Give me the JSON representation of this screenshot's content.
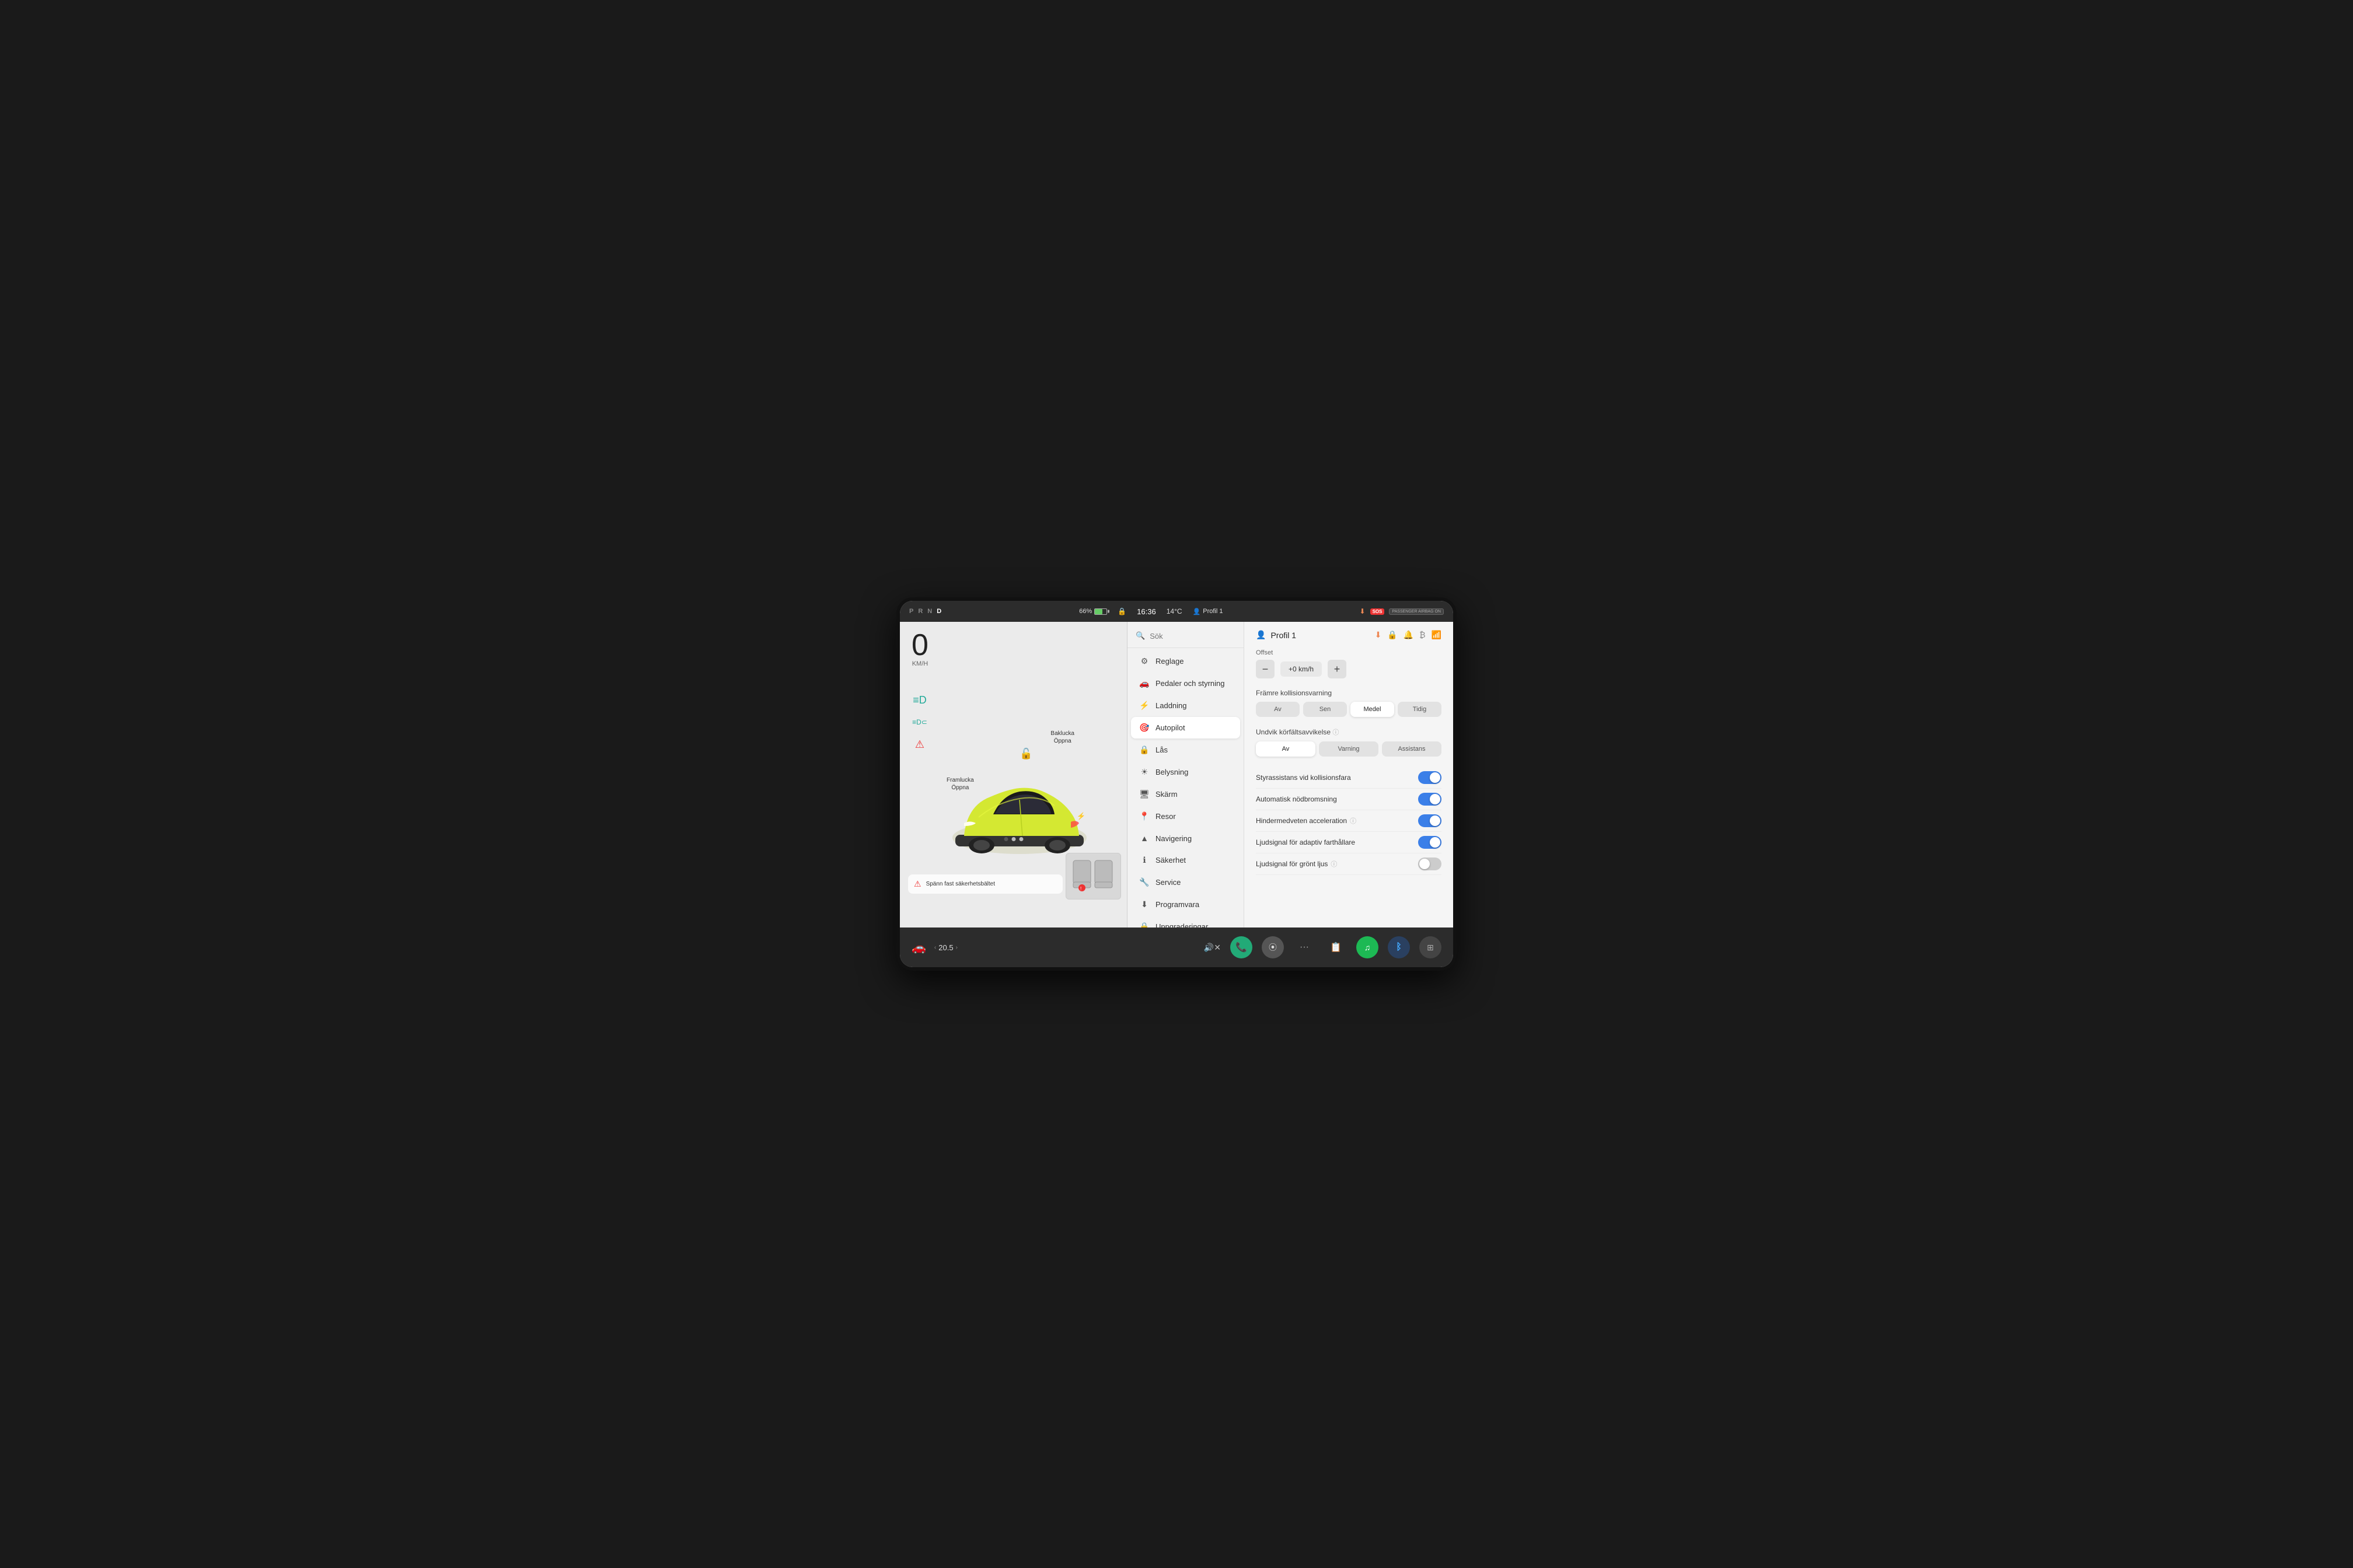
{
  "statusBar": {
    "prnd": [
      "P",
      "R",
      "N",
      "D"
    ],
    "activeGear": "D",
    "battery": "66%",
    "time": "16:36",
    "temperature": "14°C",
    "profile": "Profil 1",
    "sos": "SOS",
    "airbag": "PASSENGER AIRBAG ON"
  },
  "leftPanel": {
    "speed": "0",
    "speedUnit": "KM/H",
    "labels": {
      "framlucka": "Framlucka\nÖppna",
      "baklucka": "Baklucka\nÖppna"
    },
    "warning": "Spänn fast säkerhetsbältet",
    "pageDots": 3,
    "activePageDot": 0
  },
  "menu": {
    "searchPlaceholder": "Sök",
    "items": [
      {
        "id": "reglage",
        "label": "Reglage",
        "icon": "⚙"
      },
      {
        "id": "pedaler",
        "label": "Pedaler och styrning",
        "icon": "🚗"
      },
      {
        "id": "laddning",
        "label": "Laddning",
        "icon": "⚡"
      },
      {
        "id": "autopilot",
        "label": "Autopilot",
        "icon": "🎯",
        "active": true
      },
      {
        "id": "las",
        "label": "Lås",
        "icon": "🔒"
      },
      {
        "id": "belysning",
        "label": "Belysning",
        "icon": "☀"
      },
      {
        "id": "skarm",
        "label": "Skärm",
        "icon": "🖥"
      },
      {
        "id": "resor",
        "label": "Resor",
        "icon": "📍"
      },
      {
        "id": "navigering",
        "label": "Navigering",
        "icon": "🧭"
      },
      {
        "id": "sakerhet",
        "label": "Säkerhet",
        "icon": "ℹ"
      },
      {
        "id": "service",
        "label": "Service",
        "icon": "🔧"
      },
      {
        "id": "programvara",
        "label": "Programvara",
        "icon": "⬇"
      },
      {
        "id": "uppgraderingar",
        "label": "Uppgraderingar",
        "icon": "🔒"
      }
    ]
  },
  "rightPanel": {
    "profileName": "Profil 1",
    "offset": {
      "label": "Offset",
      "value": "+0 km/h",
      "minusLabel": "−",
      "plusLabel": "+"
    },
    "framreKollision": {
      "title": "Främre kollisionsvarning",
      "buttons": [
        "Av",
        "Sen",
        "Medel",
        "Tidig"
      ],
      "active": "Medel"
    },
    "undvikKorfalt": {
      "title": "Undvik körfältsavvikelse",
      "hasInfo": true,
      "buttons": [
        "Av",
        "Varning",
        "Assistans"
      ],
      "active": "Av"
    },
    "toggles": [
      {
        "id": "styrassistans",
        "label": "Styrassistans vid kollisionsfara",
        "on": true,
        "hasInfo": false
      },
      {
        "id": "nödbromsning",
        "label": "Automatisk nödbromsning",
        "on": true,
        "hasInfo": false
      },
      {
        "id": "hindermedveten",
        "label": "Hindermedveten acceleration",
        "on": true,
        "hasInfo": true
      },
      {
        "id": "ljudsignal-adaptiv",
        "label": "Ljudsignal för adaptiv farthållare",
        "on": true,
        "hasInfo": false
      },
      {
        "id": "ljudsignal-gront",
        "label": "Ljudsignal för grönt ljus",
        "on": false,
        "hasInfo": true
      }
    ]
  },
  "bottomBar": {
    "carIcon": "🚗",
    "temperature": "20.5",
    "icons": [
      "📞",
      "⦿",
      "···",
      "📋",
      "♫",
      "₿",
      "⊞"
    ],
    "volume": "🔊"
  }
}
